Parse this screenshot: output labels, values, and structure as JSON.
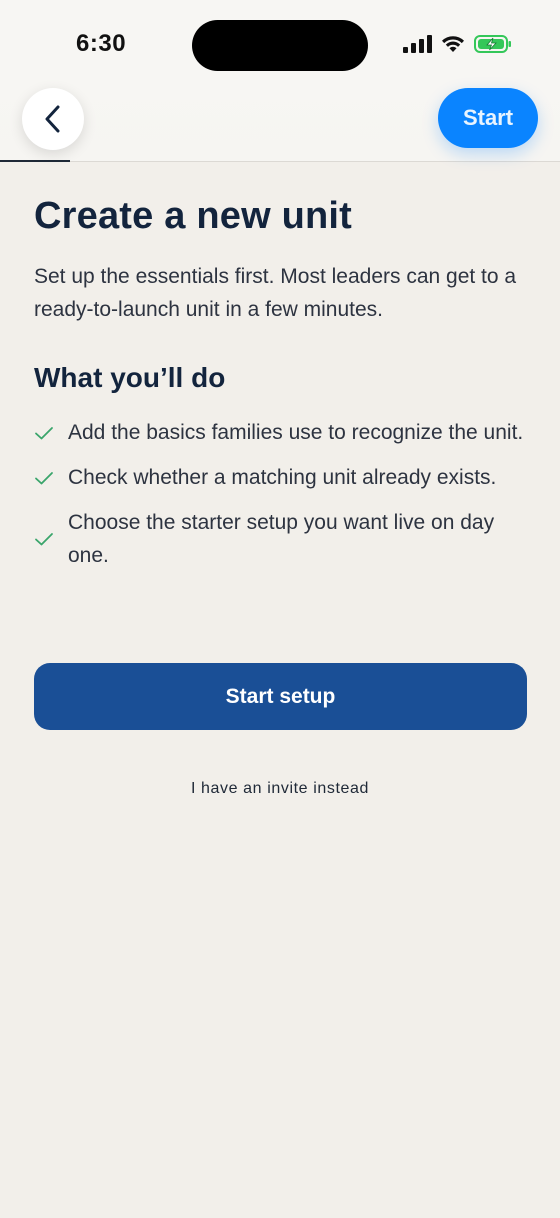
{
  "status_bar": {
    "time": "6:30"
  },
  "nav": {
    "start_label": "Start"
  },
  "main": {
    "title": "Create a new unit",
    "intro": "Set up the essentials first. Most leaders can get to a ready-to-launch unit in a few minutes.",
    "section_title": "What you’ll do",
    "items": [
      {
        "text": "Add the basics families use to recognize the unit."
      },
      {
        "text": "Check whether a matching unit already exists."
      },
      {
        "text": "Choose the starter setup you want live on day one."
      }
    ],
    "primary_button": "Start setup",
    "secondary_link": "I have an invite instead"
  },
  "colors": {
    "background": "#f2efea",
    "accent": "#0a84ff",
    "primary": "#1a4f96",
    "check": "#3aa56b",
    "heading": "#13243d"
  }
}
